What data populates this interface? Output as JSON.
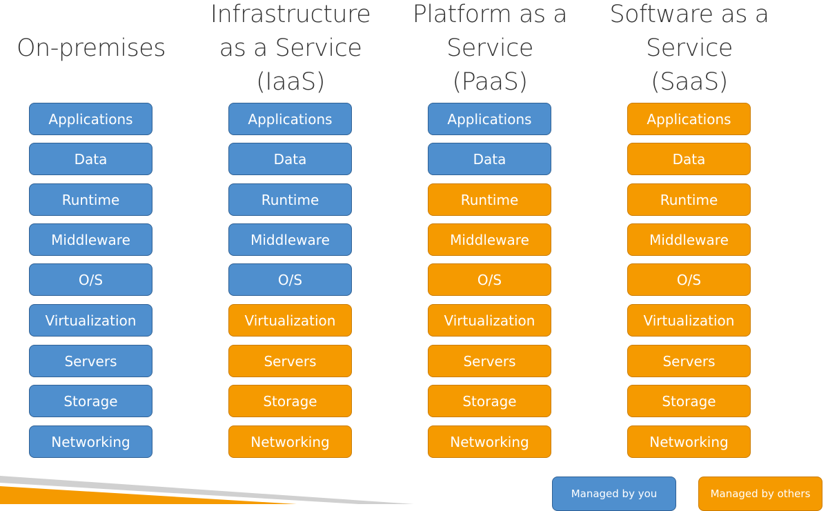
{
  "colors": {
    "you": "#4f8fce",
    "others": "#f59a00",
    "title": "#333333"
  },
  "layers": [
    "Applications",
    "Data",
    "Runtime",
    "Middleware",
    "O/S",
    "Virtualization",
    "Servers",
    "Storage",
    "Networking"
  ],
  "columns": [
    {
      "title_lines": [
        "On-premises"
      ],
      "managed_by_you_count": 9
    },
    {
      "title_lines": [
        "Infrastructure",
        "as a Service",
        "(IaaS)"
      ],
      "managed_by_you_count": 5
    },
    {
      "title_lines": [
        "Platform as a",
        "Service",
        "(PaaS)"
      ],
      "managed_by_you_count": 2
    },
    {
      "title_lines": [
        "Software as a",
        "Service",
        "(SaaS)"
      ],
      "managed_by_you_count": 0
    }
  ],
  "legend": {
    "you": "Managed by you",
    "others": "Managed by others"
  }
}
